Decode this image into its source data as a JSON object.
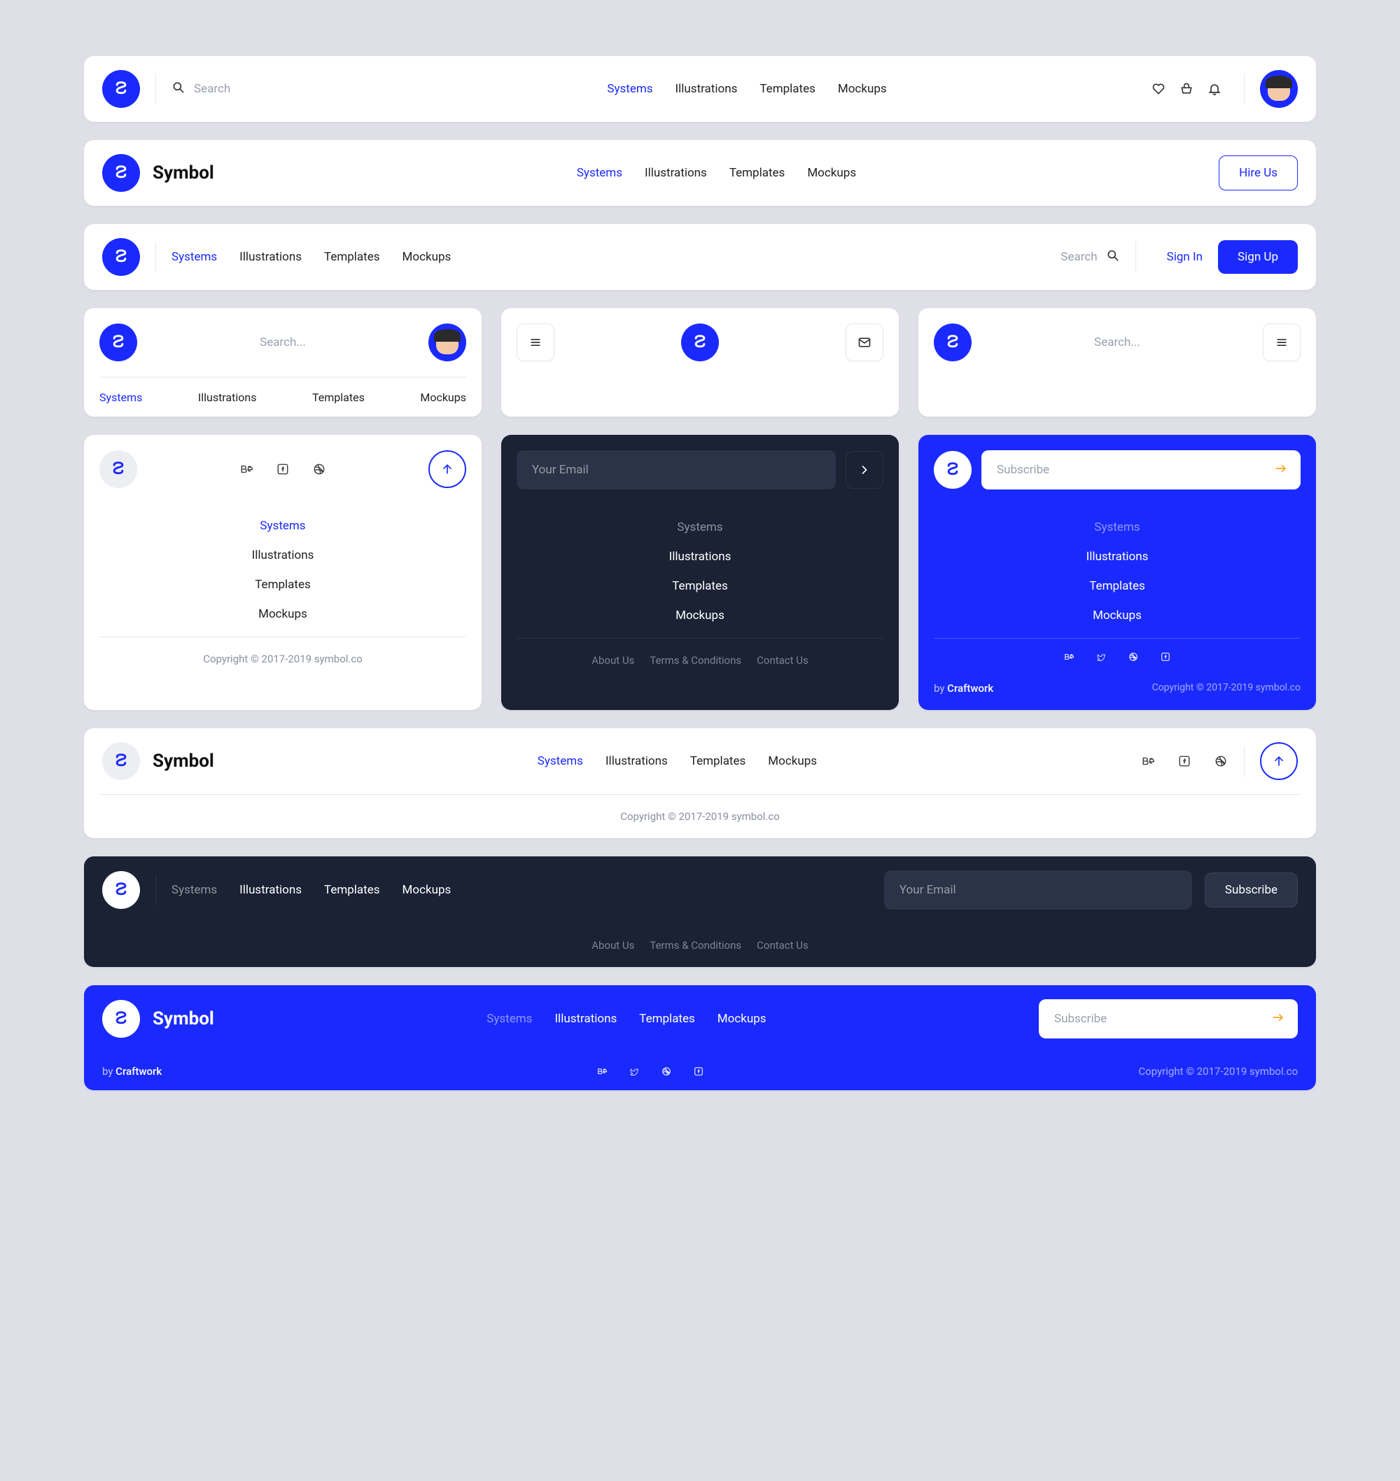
{
  "brand": "Symbol",
  "nav": {
    "systems": "Systems",
    "illustrations": "Illustrations",
    "templates": "Templates",
    "mockups": "Mockups"
  },
  "search": {
    "placeholder": "Search",
    "placeholder_dots": "Search..."
  },
  "buttons": {
    "hire_us": "Hire Us",
    "sign_in": "Sign In",
    "sign_up": "Sign Up",
    "subscribe": "Subscribe"
  },
  "email": {
    "placeholder": "Your Email",
    "subscribe_placeholder": "Subscribe"
  },
  "footer": {
    "about": "About Us",
    "terms": "Terms & Conditions",
    "contact": "Contact Us",
    "copyright": "Copyright © 2017-2019 symbol.co",
    "by": "by ",
    "craftwork": "Craftwork"
  },
  "colors": {
    "primary": "#1a2aff",
    "dark": "#1a2234",
    "bg": "#dfdfe8"
  }
}
